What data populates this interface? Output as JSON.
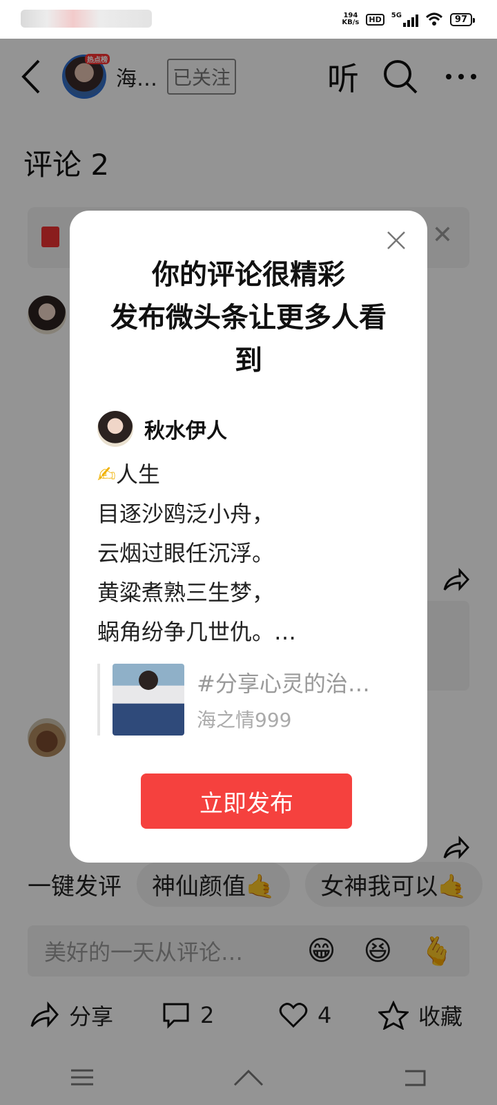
{
  "status_bar": {
    "speed_value": "194",
    "speed_unit": "KB/s",
    "hd": "HD",
    "network": "5G",
    "battery": "97"
  },
  "header": {
    "author_name": "海…",
    "avatar_tag": "热点榜",
    "follow_label": "已关注",
    "listen_label": "听"
  },
  "comments": {
    "title": "评论 2"
  },
  "quick_comments": {
    "label": "一键发评",
    "chips": [
      "神仙颜值🤙",
      "女神我可以🤙"
    ]
  },
  "input": {
    "placeholder": "美好的一天从评论…",
    "emojis": [
      "😁",
      "😆",
      "🫰"
    ]
  },
  "actions": {
    "share": "分享",
    "comments": "2",
    "likes": "4",
    "favorite": "收藏"
  },
  "modal": {
    "title_line1": "你的评论很精彩",
    "title_line2": "发布微头条让更多人看",
    "title_line3": "到",
    "user_name": "秋水伊人",
    "poem": {
      "pen": "✍",
      "title": "人生",
      "lines": [
        "目逐沙鸥泛小舟，",
        "云烟过眼任沉浮。",
        "黄粱煮熟三生梦，",
        "蜗角纷争几世仇。…"
      ]
    },
    "quote": {
      "topic": "#分享心灵的治…",
      "author": "海之情999"
    },
    "publish_label": "立即发布"
  }
}
